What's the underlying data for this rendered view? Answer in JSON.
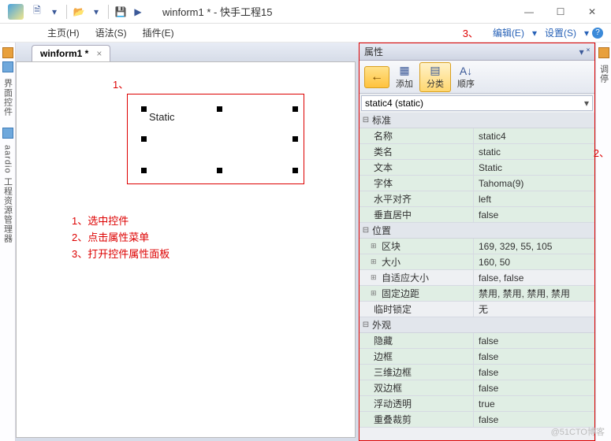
{
  "window": {
    "title": "winform1 * - 快手工程15"
  },
  "menubar": {
    "items": [
      "主页(H)",
      "语法(S)",
      "插件(E)"
    ],
    "right": [
      "编辑(E)",
      "设置(S)"
    ]
  },
  "left_rails": [
    {
      "label": "界面控件"
    },
    {
      "label": "aardio 工程资源管理器"
    }
  ],
  "right_rail": {
    "label": "调停"
  },
  "tab": {
    "label": "winform1 *"
  },
  "canvas": {
    "static_text": "Static"
  },
  "annotations": {
    "n1": "1、",
    "n2": "2、",
    "n3": "3、",
    "lines": [
      "1、选中控件",
      "2、点击属性菜单",
      "3、打开控件属性面板"
    ]
  },
  "properties": {
    "title": "属性",
    "toolbar": {
      "back": "←",
      "add": "添加",
      "group": "分类",
      "sort": "顺序"
    },
    "selector": "static4 (static)",
    "groups": [
      {
        "name": "标准",
        "rows": [
          {
            "n": "名称",
            "v": "static4",
            "alt": true
          },
          {
            "n": "类名",
            "v": "static",
            "alt": true
          },
          {
            "n": "文本",
            "v": "Static",
            "alt": true
          },
          {
            "n": "字体",
            "v": "Tahoma(9)",
            "alt": true
          },
          {
            "n": "水平对齐",
            "v": "left",
            "alt": true
          },
          {
            "n": "垂直居中",
            "v": "false",
            "alt": true
          }
        ]
      },
      {
        "name": "位置",
        "rows": [
          {
            "n": "区块",
            "v": "169, 329, 55, 105",
            "alt": true,
            "sub": true
          },
          {
            "n": "大小",
            "v": "160, 50",
            "alt": true,
            "sub": true
          },
          {
            "n": "自适应大小",
            "v": "false, false",
            "alt": false,
            "sub": true
          },
          {
            "n": "固定边距",
            "v": "禁用, 禁用, 禁用, 禁用",
            "alt": true,
            "sub": true
          },
          {
            "n": "临时锁定",
            "v": "无",
            "alt": false
          }
        ]
      },
      {
        "name": "外观",
        "rows": [
          {
            "n": "隐藏",
            "v": "false",
            "alt": true
          },
          {
            "n": "边框",
            "v": "false",
            "alt": true
          },
          {
            "n": "三维边框",
            "v": "false",
            "alt": true
          },
          {
            "n": "双边框",
            "v": "false",
            "alt": true
          },
          {
            "n": "浮动透明",
            "v": "true",
            "alt": true
          },
          {
            "n": "重叠裁剪",
            "v": "false",
            "alt": true
          }
        ]
      }
    ]
  },
  "watermark": "@51CTO博客"
}
